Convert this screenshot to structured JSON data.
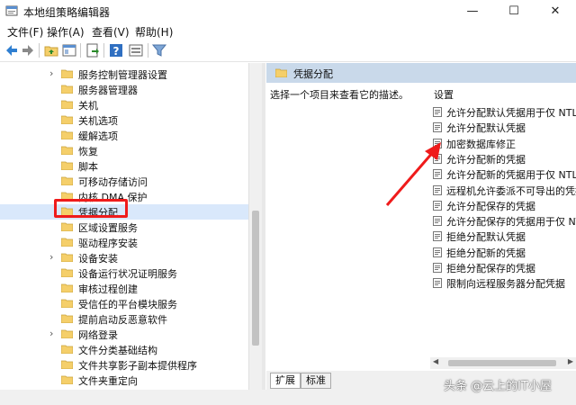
{
  "window": {
    "title": "本地组策略编辑器",
    "minimize": "—",
    "maximize": "☐",
    "close": "✕"
  },
  "menu": [
    "文件(F)",
    "操作(A)",
    "查看(V)",
    "帮助(H)"
  ],
  "toolbar": [
    "back-icon",
    "forward-icon",
    "up-folder-icon",
    "show-hide-tree-icon",
    "export-list-icon",
    "help-icon",
    "properties-icon",
    "filter-icon"
  ],
  "tree": [
    {
      "label": "服务控制管理器设置",
      "chevron": "›"
    },
    {
      "label": "服务器管理器",
      "chevron": ""
    },
    {
      "label": "关机",
      "chevron": ""
    },
    {
      "label": "关机选项",
      "chevron": ""
    },
    {
      "label": "缓解选项",
      "chevron": ""
    },
    {
      "label": "恢复",
      "chevron": ""
    },
    {
      "label": "脚本",
      "chevron": ""
    },
    {
      "label": "可移动存储访问",
      "chevron": ""
    },
    {
      "label": "内核 DMA 保护",
      "chevron": ""
    },
    {
      "label": "凭据分配",
      "chevron": ""
    },
    {
      "label": "区域设置服务",
      "chevron": ""
    },
    {
      "label": "驱动程序安装",
      "chevron": ""
    },
    {
      "label": "设备安装",
      "chevron": "›"
    },
    {
      "label": "设备运行状况证明服务",
      "chevron": ""
    },
    {
      "label": "审核过程创建",
      "chevron": ""
    },
    {
      "label": "受信任的平台模块服务",
      "chevron": ""
    },
    {
      "label": "提前启动反恶意软件",
      "chevron": ""
    },
    {
      "label": "网络登录",
      "chevron": "›"
    },
    {
      "label": "文件分类基础结构",
      "chevron": ""
    },
    {
      "label": "文件共享影子副本提供程序",
      "chevron": ""
    },
    {
      "label": "文件夹重定向",
      "chevron": ""
    }
  ],
  "selected_index": 9,
  "right": {
    "header": "凭据分配",
    "description": "选择一个项目来查看它的描述。",
    "settings_header": "设置",
    "settings": [
      "允许分配默认凭据用于仅 NTLM",
      "允许分配默认凭据",
      "加密数据库修正",
      "允许分配新的凭据",
      "允许分配新的凭据用于仅 NTLM",
      "远程机允许委派不可导出的凭据",
      "允许分配保存的凭据",
      "允许分配保存的凭据用于仅 NTLM",
      "拒绝分配默认凭据",
      "拒绝分配新的凭据",
      "拒绝分配保存的凭据",
      "限制向远程服务器分配凭据"
    ]
  },
  "tabs": [
    "扩展",
    "标准"
  ],
  "watermark": "头条 @云上的IT小屋",
  "colors": {
    "highlight": "#ef1b1b",
    "arrow": "#ef1b1b",
    "header_bg": "#c9d9ea",
    "folder": "#f5cf6a"
  }
}
